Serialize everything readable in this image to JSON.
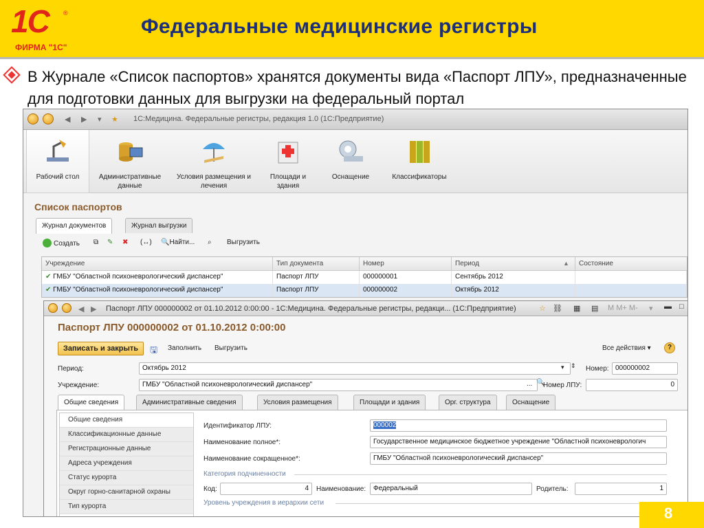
{
  "slide": {
    "logo_text": "1С",
    "logo_sub": "ФИРМА \"1С\"",
    "title": "Федеральные медицинские регистры",
    "bullet_text": "В Журнале «Список паспортов» хранятся документы вида «Паспорт ЛПУ», предназначенные для подготовки данных для выгрузки на федеральный портал",
    "page_number": "8"
  },
  "main_window": {
    "title": "1С:Медицина. Федеральные регистры, редакция 1.0  (1С:Предприятие)",
    "sections": [
      {
        "label": "Рабочий стол",
        "icon": "desk-lamp-icon"
      },
      {
        "label": "Административные данные",
        "icon": "database-computer-icon"
      },
      {
        "label": "Условия размещения и лечения",
        "icon": "umbrella-lounge-icon"
      },
      {
        "label": "Площади и здания",
        "icon": "hospital-building-icon"
      },
      {
        "label": "Оснащение",
        "icon": "medical-scanner-icon"
      },
      {
        "label": "Классификаторы",
        "icon": "binders-icon"
      }
    ],
    "list_title": "Список паспортов",
    "tabs": [
      "Журнал документов",
      "Журнал выгрузки"
    ],
    "toolbar": {
      "create": "Создать",
      "find": "Найти...",
      "export": "Выгрузить"
    },
    "columns": [
      "Учреждение",
      "Тип документа",
      "Номер",
      "Период",
      "Состояние"
    ],
    "rows": [
      {
        "org": "ГМБУ \"Областной психоневрологический диспансер\"",
        "type": "Паспорт ЛПУ",
        "number": "000000001",
        "period": "Сентябрь 2012",
        "state": ""
      },
      {
        "org": "ГМБУ \"Областной психоневрологический диспансер\"",
        "type": "Паспорт ЛПУ",
        "number": "000000002",
        "period": "Октябрь 2012",
        "state": ""
      }
    ]
  },
  "passport_window": {
    "title": "Паспорт ЛПУ 000000002 от 01.10.2012 0:00:00 - 1С:Медицина. Федеральные регистры, редакци...  (1С:Предприятие)",
    "doc_title": "Паспорт ЛПУ 000000002 от 01.10.2012 0:00:00",
    "toolbar": {
      "save_close": "Записать и закрыть",
      "fill": "Заполнить",
      "export": "Выгрузить",
      "all_actions": "Все действия"
    },
    "fields": {
      "period_label": "Период:",
      "period_value": "Октябрь 2012",
      "number_label": "Номер:",
      "number_value": "000000002",
      "org_label": "Учреждение:",
      "org_value": "ГМБУ \"Областной психоневрологический диспансер\"",
      "lpu_num_label": "Номер ЛПУ:",
      "lpu_num_value": "0"
    },
    "tabs": [
      "Общие сведения",
      "Административные сведения",
      "Условия размещения",
      "Площади и здания",
      "Орг. структура",
      "Оснащение"
    ],
    "left_nav": [
      "Общие сведения",
      "Классификационные данные",
      "Регистрационные данные",
      "Адреса учреждения",
      "Статус курорта",
      "Округ горно-санитарной охраны",
      "Тип курорта"
    ],
    "details": {
      "id_label": "Идентификатор ЛПУ:",
      "id_value": "000002",
      "full_name_label": "Наименование полное*:",
      "full_name_value": "Государственное медицинское бюджетное учреждение \"Областной психоневрологич",
      "short_name_label": "Наименование сокращенное*:",
      "short_name_value": "ГМБУ \"Областной психоневрологический диспансер\"",
      "group_subordination": "Категория подчиненности",
      "code_label": "Код:",
      "code_value": "4",
      "name_label": "Наименование:",
      "name_value": "Федеральный",
      "parent_label": "Родитель:",
      "parent_value": "1",
      "group_hierarchy": "Уровень учреждения в иерархии сети"
    }
  },
  "colors": {
    "header_yellow": "#ffd800",
    "title_blue": "#1d2f79",
    "brand_red": "#e1251b",
    "doc_title_brown": "#8b5a2b"
  }
}
